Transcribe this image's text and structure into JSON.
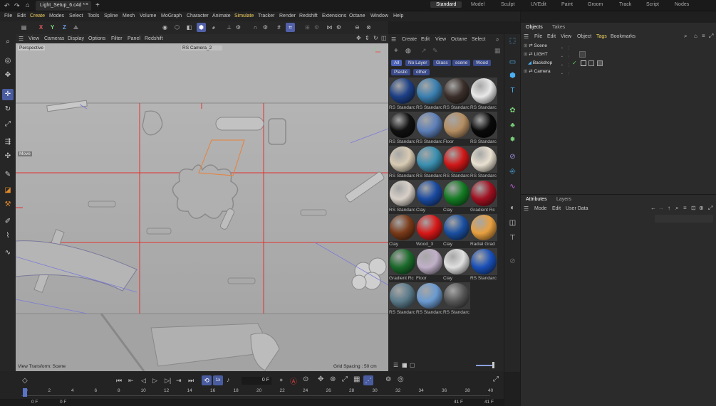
{
  "window": {
    "tab_title": "Light_Setup_6.c4d *",
    "workspaces": [
      "Standard",
      "Model",
      "Sculpt",
      "UVEdit",
      "Paint",
      "Groom",
      "Track",
      "Script",
      "Nodes"
    ],
    "active_workspace": "Standard"
  },
  "menu": [
    "File",
    "Edit",
    "Create",
    "Modes",
    "Select",
    "Tools",
    "Spline",
    "Mesh",
    "Volume",
    "MoGraph",
    "Character",
    "Animate",
    "Simulate",
    "Tracker",
    "Render",
    "Redshift",
    "Extensions",
    "Octane",
    "Window",
    "Help"
  ],
  "toolbar": {
    "axes": [
      "X",
      "Y",
      "Z"
    ]
  },
  "viewport": {
    "menu": [
      "View",
      "Cameras",
      "Display",
      "Options",
      "Filter",
      "Panel",
      "Redshift"
    ],
    "label_perspective": "Perspective",
    "camera": "RS Camera_2",
    "move_label": "Move",
    "view_transform": "View Transform: Scene",
    "grid_spacing": "Grid Spacing : 50 cm"
  },
  "materials": {
    "menu": [
      "Create",
      "Edit",
      "View",
      "Octane",
      "Select"
    ],
    "filters": [
      "All",
      "No Layer",
      "Glass",
      "scene",
      "Wood",
      "Plastic",
      "other"
    ],
    "items": [
      {
        "label": "RS Standarc",
        "color": "#1c3f86"
      },
      {
        "label": "RS Standarc",
        "color": "#3a7fb0"
      },
      {
        "label": "RS Standarc",
        "color": "#3b2f2a"
      },
      {
        "label": "RS Standarc",
        "color": "#e8e8e8"
      },
      {
        "label": "RS Standarc",
        "color": "#111111"
      },
      {
        "label": "RS Standarc",
        "color": "#5d7fb8"
      },
      {
        "label": "Floor",
        "color": "#b58e62"
      },
      {
        "label": "RS Standarc",
        "color": "#0a0a0a"
      },
      {
        "label": "RS Standarc",
        "color": "#d8cbb3"
      },
      {
        "label": "RS Standarc",
        "color": "#3a8fb0"
      },
      {
        "label": "RS Standarc",
        "color": "#d01818"
      },
      {
        "label": "RS Standarc",
        "color": "#e8e0d0"
      },
      {
        "label": "RS Standarc",
        "color": "#d8d0c8"
      },
      {
        "label": "Clay",
        "color": "#1a4aa0"
      },
      {
        "label": "Clay",
        "color": "#137a22"
      },
      {
        "label": "Gradient Rc",
        "color": "#a01020"
      },
      {
        "label": "Clay",
        "color": "#7a3a18"
      },
      {
        "label": "Wood_3",
        "color": "#d81818"
      },
      {
        "label": "Clay",
        "color": "#1a4fa0"
      },
      {
        "label": "Radial Grad",
        "color": "#e8a040"
      },
      {
        "label": "Gradient Rc",
        "color": "#1a6a2a"
      },
      {
        "label": "Floor",
        "color": "#c0b0c8"
      },
      {
        "label": "Clay",
        "color": "#e0e0e0"
      },
      {
        "label": "RS Standarc",
        "color": "#1a50b8"
      },
      {
        "label": "RS Standarc",
        "color": "#5a7a8a"
      },
      {
        "label": "RS Standarc",
        "color": "#6a9ad0"
      },
      {
        "label": "RS Standarc",
        "color": "#555555"
      }
    ]
  },
  "objects": {
    "tabs": [
      "Objects",
      "Takes"
    ],
    "menu": [
      "File",
      "Edit",
      "View",
      "Object",
      "Tags",
      "Bookmarks"
    ],
    "items": [
      "Scene",
      "LIGHT",
      "Backdrop",
      "Camera"
    ]
  },
  "attributes": {
    "tabs": [
      "Attributes",
      "Layers"
    ],
    "menu": [
      "Mode",
      "Edit",
      "User Data"
    ]
  },
  "timeline": {
    "current_frame": "0 F",
    "ruler_ticks": [
      "0",
      "2",
      "4",
      "6",
      "8",
      "10",
      "12",
      "14",
      "16",
      "18",
      "20",
      "22",
      "24",
      "26",
      "28",
      "30",
      "32",
      "34",
      "36",
      "38",
      "40"
    ],
    "start_frame": "0 F",
    "start_frame_2": "0 F",
    "end_frame": "41 F",
    "end_frame_2": "41 F"
  }
}
